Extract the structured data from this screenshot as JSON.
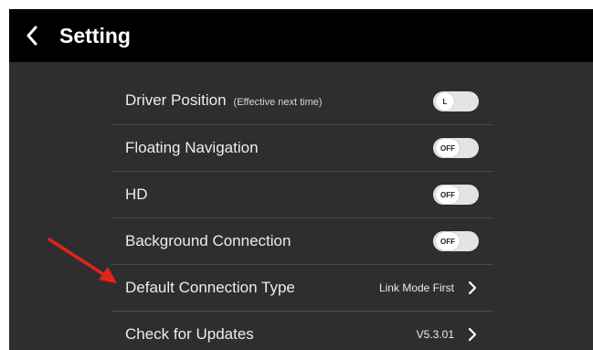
{
  "header": {
    "title": "Setting",
    "back_icon": "back-chevron-icon"
  },
  "settings": [
    {
      "label": "Driver Position",
      "sublabel": "(Effective next time)",
      "control": "toggle",
      "state": "L"
    },
    {
      "label": "Floating Navigation",
      "control": "toggle",
      "state": "OFF"
    },
    {
      "label": "HD",
      "control": "toggle",
      "state": "OFF"
    },
    {
      "label": "Background Connection",
      "control": "toggle",
      "state": "OFF"
    },
    {
      "label": "Default Connection Type",
      "control": "link",
      "value": "Link Mode First"
    },
    {
      "label": "Check for Updates",
      "control": "link",
      "value": "V5.3.01"
    }
  ],
  "colors": {
    "background": "#2e2e2e",
    "header": "#000000",
    "toggle_track": "#e4e4e4",
    "annotation_arrow": "#e0241c"
  }
}
